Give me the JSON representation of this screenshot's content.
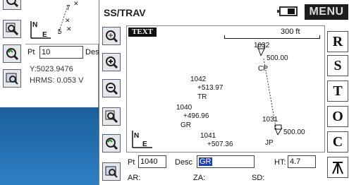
{
  "back_window": {
    "map_labels": {
      "pt_seven": "7",
      "pt_five": "5"
    },
    "pt_label": "Pt",
    "pt_value": "10",
    "desc_label": "Des",
    "y_readout": "Y:5023.9476",
    "hrms_readout": "HRMS: 0.053  V"
  },
  "main": {
    "title": "SS/TRAV",
    "menu_label": "MENU",
    "plot": {
      "text_badge": "TEXT",
      "scale_label": "300 ft",
      "points": [
        {
          "id": "1032",
          "elev": "500.00",
          "desc": "CP"
        },
        {
          "id": "1042",
          "elev": "+513.97",
          "desc": "TR"
        },
        {
          "id": "1040",
          "elev": "+496.96",
          "desc": "GR"
        },
        {
          "id": "1041",
          "elev": "+507.36",
          "desc": ""
        },
        {
          "id": "1031",
          "elev": "500.00",
          "desc": "JP"
        }
      ]
    },
    "right_buttons": [
      "R",
      "S",
      "T",
      "O",
      "C"
    ],
    "form": {
      "pt_label": "Pt",
      "pt_value": "1040",
      "desc_label": "Desc",
      "desc_value": "GR",
      "ht_label": "HT:",
      "ht_value": "4.7",
      "ar_label": "AR:",
      "za_label": "ZA:",
      "sd_label": "SD:"
    }
  },
  "colors": {
    "desktop": "#1e6aa8",
    "selected_field": "#1f3fb5",
    "menu_bg": "#1c1c1c"
  }
}
